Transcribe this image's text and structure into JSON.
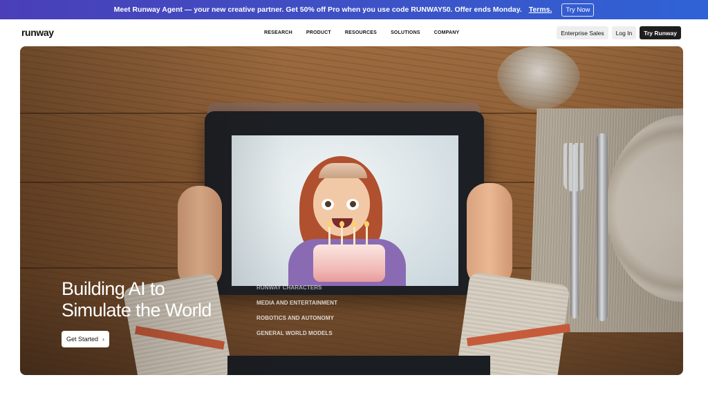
{
  "promo": {
    "message": "Meet Runway Agent — your new creative partner. Get 50% off Pro when you use code RUNWAY50. Offer ends Monday.",
    "terms_label": "Terms.",
    "cta_label": "Try Now"
  },
  "header": {
    "logo": "runway",
    "nav": [
      "RESEARCH",
      "PRODUCT",
      "RESOURCES",
      "SOLUTIONS",
      "COMPANY"
    ],
    "actions": {
      "enterprise": "Enterprise Sales",
      "login": "Log In",
      "try": "Try Runway"
    }
  },
  "hero": {
    "title_line1": "Building AI to",
    "title_line2": "Simulate the World",
    "categories": [
      "RUNWAY CHARACTERS",
      "MEDIA AND ENTERTAINMENT",
      "ROBOTICS AND AUTONOMY",
      "GENERAL WORLD MODELS"
    ],
    "cta_label": "Get Started",
    "cta_icon": "chevron-right-icon"
  }
}
